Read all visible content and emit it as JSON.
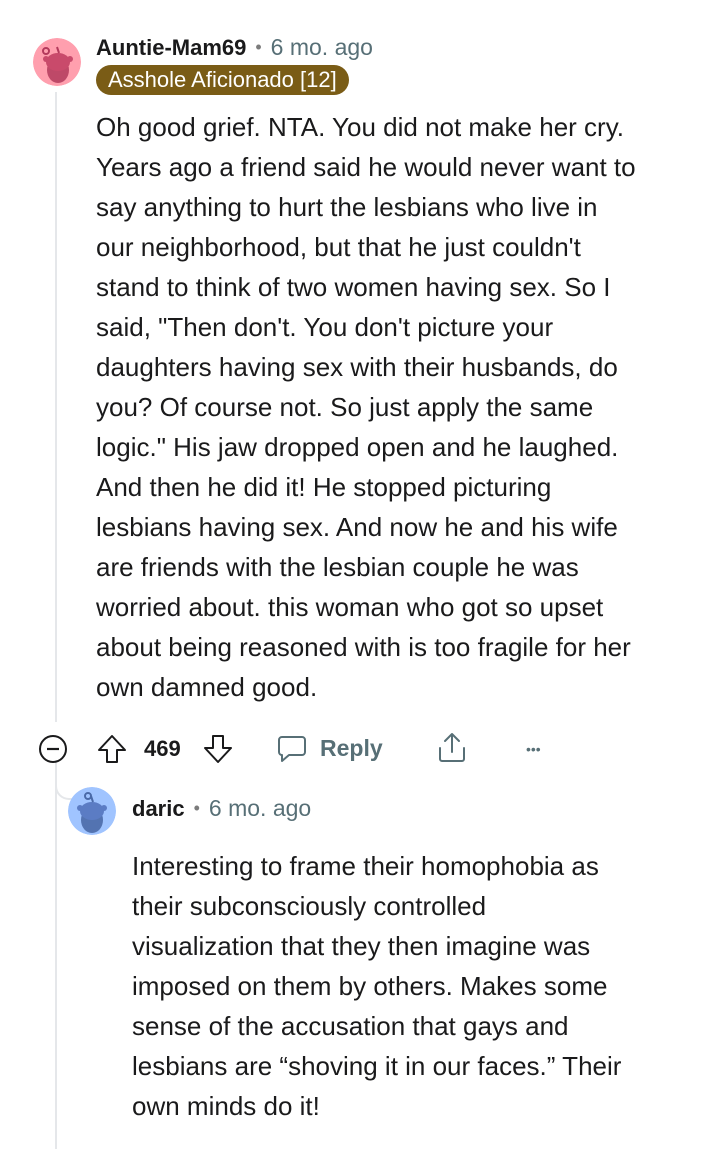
{
  "comment": {
    "username": "Auntie-Mam69",
    "separator": "•",
    "age": "6 mo. ago",
    "flair": "Asshole Aficionado [12]",
    "avatar_icon": "snoo-avatar-pink",
    "body": "Oh good grief. NTA. You did not make her cry.\nYears ago a friend said he would never want to\nsay anything to hurt the lesbians who live in\nour neighborhood, but that he just couldn't\nstand to think of two women having sex. So I\nsaid, \"Then don't. You don't picture your\ndaughters having sex with their husbands, do\nyou? Of course not. So just apply the same\nlogic.\" His jaw dropped open and he laughed.\nAnd then he did it! He stopped picturing\nlesbians having sex. And now he and his wife\nare friends with the lesbian couple he was\nworried about. this woman who got so upset\nabout being reasoned with is too fragile for her\nown damned good.",
    "actions": {
      "vote_count": "469",
      "reply_label": "Reply",
      "more_label": "•••"
    }
  },
  "reply": {
    "username": "daric",
    "separator": "•",
    "age": "6 mo. ago",
    "avatar_icon": "snoo-avatar-blue",
    "body": "Interesting to frame their homophobia as\ntheir subconsciously controlled\nvisualization that they then imagine was\nimposed on them by others. Makes some\nsense of the accusation that gays and\nlesbians are “shoving it in our faces.” Their\nown minds do it!"
  },
  "colors": {
    "flair_bg": "#7a5c16",
    "avatar_pink": "#ff9fae",
    "avatar_blue": "#a0c4ff",
    "meta_text": "#576f76"
  }
}
